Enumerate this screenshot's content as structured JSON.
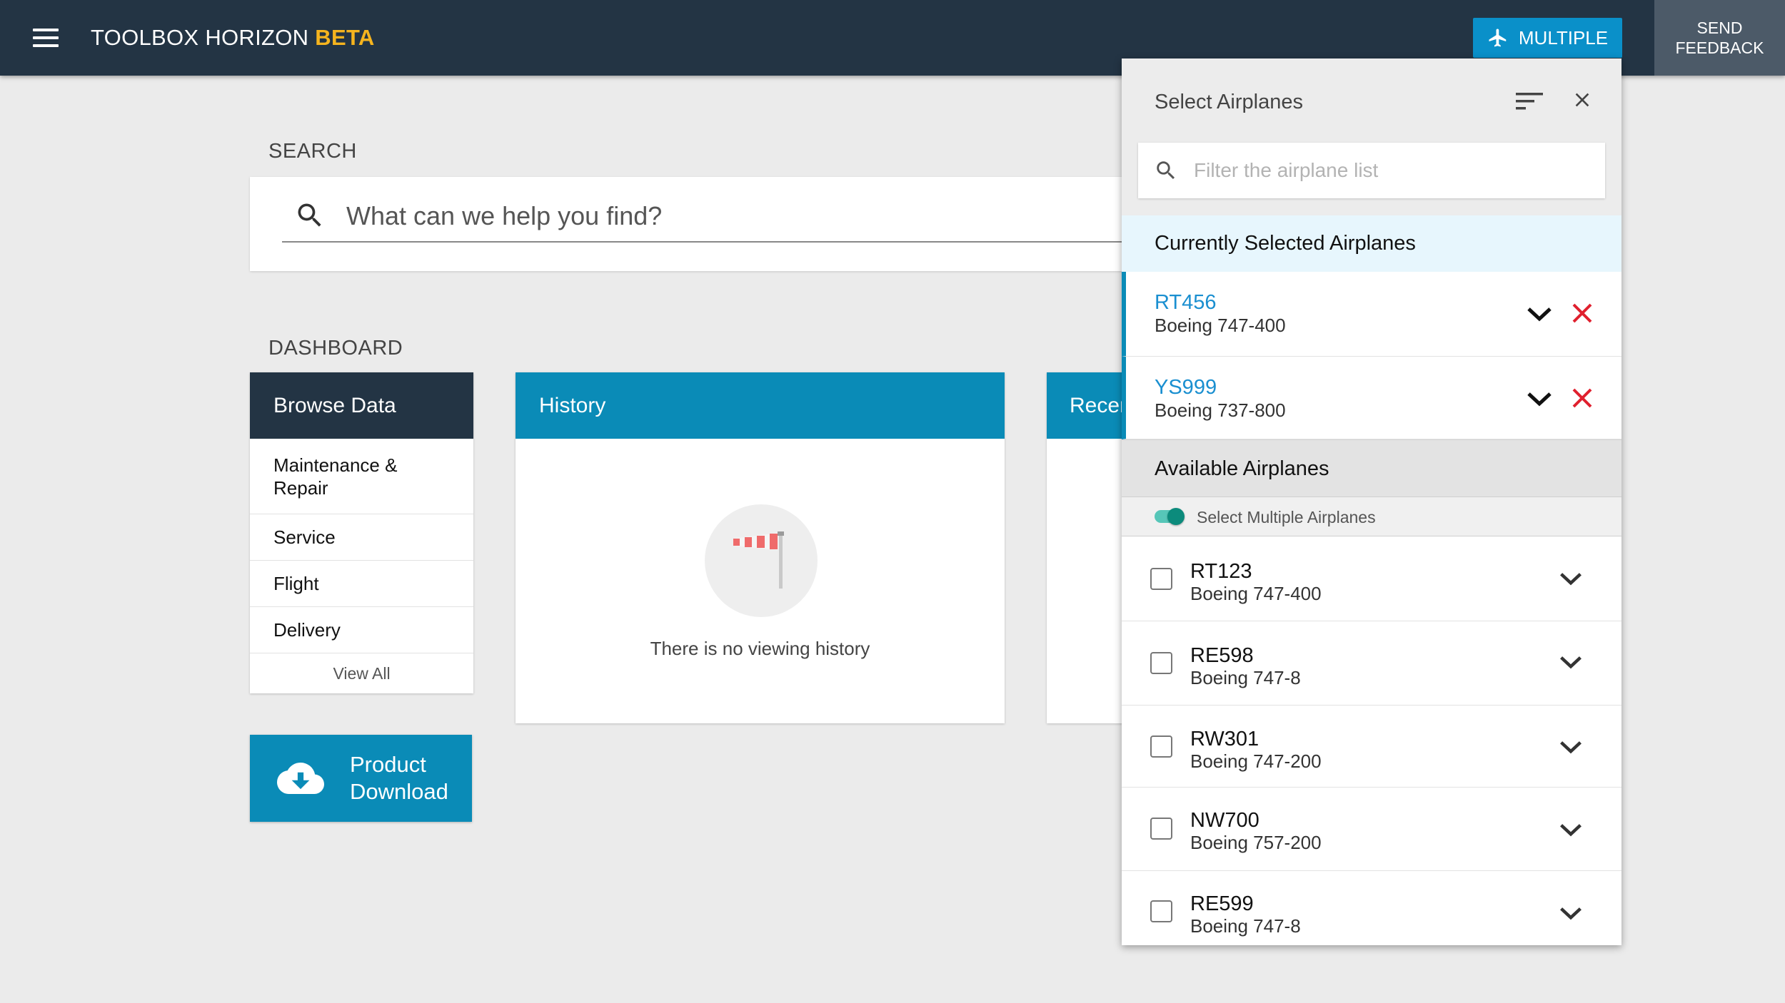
{
  "header": {
    "app_title": "TOOLBOX HORIZON",
    "app_badge": "BETA",
    "multiple_button": "MULTIPLE",
    "send_feedback_line1": "SEND",
    "send_feedback_line2": "FEEDBACK"
  },
  "search": {
    "section_label": "SEARCH",
    "placeholder": "What can we help you find?"
  },
  "dashboard": {
    "section_label": "DASHBOARD",
    "browse": {
      "title": "Browse Data",
      "items": [
        "Maintenance & Repair",
        "Service",
        "Flight",
        "Delivery"
      ],
      "view_all": "View All"
    },
    "product_download": {
      "line1": "Product",
      "line2": "Download"
    },
    "history": {
      "title": "History",
      "empty_text": "There is no viewing history"
    },
    "recent": {
      "title": "Recently Viewed"
    }
  },
  "airplane_panel": {
    "title": "Select Airplanes",
    "filter_placeholder": "Filter the airplane list",
    "currently_selected_heading": "Currently Selected Airplanes",
    "selected": [
      {
        "code": "RT456",
        "model": "Boeing 747-400"
      },
      {
        "code": "YS999",
        "model": "Boeing 737-800"
      }
    ],
    "available_heading": "Available Airplanes",
    "multi_select_label": "Select Multiple Airplanes",
    "multi_select_on": true,
    "available": [
      {
        "code": "RT123",
        "model": "Boeing 747-400",
        "checked": false
      },
      {
        "code": "RE598",
        "model": "Boeing 747-8",
        "checked": false
      },
      {
        "code": "RW301",
        "model": "Boeing 747-200",
        "checked": false
      },
      {
        "code": "NW700",
        "model": "Boeing 757-200",
        "checked": false
      },
      {
        "code": "RE599",
        "model": "Boeing 747-8",
        "checked": false
      }
    ]
  },
  "colors": {
    "navy": "#233444",
    "accent_blue": "#0a8bb7",
    "beta_yellow": "#f5b41e",
    "remove_red": "#e0202e",
    "toggle_teal": "#0c8b7c"
  }
}
